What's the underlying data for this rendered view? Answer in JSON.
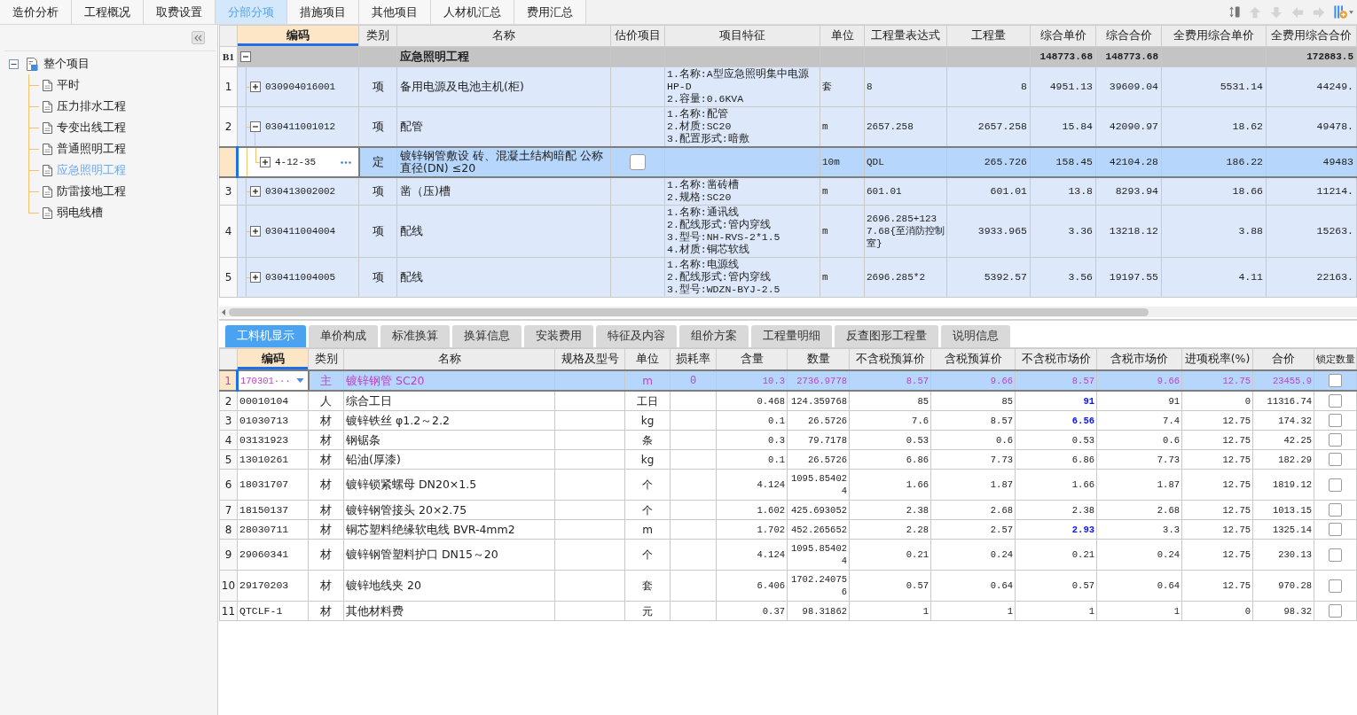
{
  "top_tabs": [
    {
      "label": "造价分析",
      "selected": false
    },
    {
      "label": "工程概况",
      "selected": false
    },
    {
      "label": "取费设置",
      "selected": false
    },
    {
      "label": "分部分项",
      "selected": true
    },
    {
      "label": "措施项目",
      "selected": false
    },
    {
      "label": "其他项目",
      "selected": false
    },
    {
      "label": "人材机汇总",
      "selected": false
    },
    {
      "label": "费用汇总",
      "selected": false
    }
  ],
  "toolbar": [
    {
      "kind": "sort",
      "disabled": false
    },
    {
      "kind": "up",
      "disabled": true
    },
    {
      "kind": "down",
      "disabled": true
    },
    {
      "kind": "left",
      "disabled": true
    },
    {
      "kind": "right",
      "disabled": true
    },
    {
      "kind": "columns",
      "disabled": false
    }
  ],
  "tree": {
    "label": "整个项目",
    "expanded": true,
    "selected": false,
    "children": [
      {
        "label": "平时",
        "selected": false
      },
      {
        "label": "压力排水工程",
        "selected": false
      },
      {
        "label": "专变出线工程",
        "selected": false
      },
      {
        "label": "普通照明工程",
        "selected": false
      },
      {
        "label": "应急照明工程",
        "selected": true
      },
      {
        "label": "防雷接地工程",
        "selected": false
      },
      {
        "label": "弱电线槽",
        "selected": false
      }
    ]
  },
  "bill_table": {
    "columns": [
      {
        "label": "编码",
        "selected": true
      },
      {
        "label": "类别",
        "selected": false
      },
      {
        "label": "名称",
        "selected": false
      },
      {
        "label": "估价项目",
        "selected": false
      },
      {
        "label": "项目特征",
        "selected": false
      },
      {
        "label": "单位",
        "selected": false
      },
      {
        "label": "工程量表达式",
        "selected": false
      },
      {
        "label": "工程量",
        "selected": false
      },
      {
        "label": "综合单价",
        "selected": false
      },
      {
        "label": "综合合价",
        "selected": false
      },
      {
        "label": "全费用综合单价",
        "selected": false
      },
      {
        "label": "全费用综合合价",
        "selected": false
      }
    ],
    "rows": [
      {
        "kind": "section",
        "number": "B1",
        "expanded": true,
        "name": "应急照明工程",
        "unit_price": "148773.68",
        "total": "148773.68",
        "full_total": "172883.5",
        "selected": false
      },
      {
        "kind": "item",
        "number": "1",
        "code": "030904016001",
        "expanded": false,
        "type": "项",
        "name": "备用电源及电池主机(柜)",
        "features": [
          "1.名称:A型应急照明集中电源",
          "HP-D",
          "2.容量:0.6KVA"
        ],
        "unit": "套",
        "expression": "8",
        "quantity": "8",
        "unit_price": "4951.13",
        "total": "39609.04",
        "full_unit_price": "5531.14",
        "full_total": "44249.",
        "selected": false
      },
      {
        "kind": "item",
        "number": "2",
        "code": "030411001012",
        "expanded": true,
        "type": "项",
        "name": "配管",
        "features": [
          "1.名称:配管",
          "2.材质:SC20",
          "3.配置形式:暗敷"
        ],
        "unit": "m",
        "expression": "2657.258",
        "quantity": "2657.258",
        "unit_price": "15.84",
        "total": "42090.97",
        "full_unit_price": "18.62",
        "full_total": "49478.",
        "selected": false
      },
      {
        "kind": "quota",
        "code": "4-12-35",
        "expanded": false,
        "type": "定",
        "name": "镀锌钢管敷设 砖、混凝土结构暗配 公称直径(DN) ≤20",
        "estimate_checked": false,
        "unit": "10m",
        "expression": "QDL",
        "quantity": "265.726",
        "unit_price": "158.45",
        "total": "42104.28",
        "full_unit_price": "186.22",
        "full_total": "49483",
        "selected": true
      },
      {
        "kind": "item",
        "number": "3",
        "code": "030413002002",
        "expanded": false,
        "type": "项",
        "name": "凿（压)槽",
        "features": [
          "1.名称:凿砖槽",
          "2.规格:SC20"
        ],
        "unit": "m",
        "expression": "601.01",
        "quantity": "601.01",
        "unit_price": "13.8",
        "total": "8293.94",
        "full_unit_price": "18.66",
        "full_total": "11214.",
        "selected": false
      },
      {
        "kind": "item",
        "number": "4",
        "code": "030411004004",
        "expanded": false,
        "type": "项",
        "name": "配线",
        "features": [
          "1.名称:通讯线",
          "2.配线形式:管内穿线",
          "3.型号:NH-RVS-2*1.5",
          "4.材质:铜芯软线"
        ],
        "unit": "m",
        "expression": "2696.285+1237.68{至消防控制室}",
        "quantity": "3933.965",
        "unit_price": "3.36",
        "total": "13218.12",
        "full_unit_price": "3.88",
        "full_total": "15263.",
        "selected": false
      },
      {
        "kind": "item",
        "number": "5",
        "code": "030411004005",
        "expanded": false,
        "type": "项",
        "name": "配线",
        "features": [
          "1.名称:电源线",
          "2.配线形式:管内穿线",
          "3.型号:WDZN-BYJ-2.5"
        ],
        "unit": "m",
        "expression": "2696.285*2",
        "quantity": "5392.57",
        "unit_price": "3.56",
        "total": "19197.55",
        "full_unit_price": "4.11",
        "full_total": "22163.",
        "selected": false
      }
    ]
  },
  "detail_tabs": [
    {
      "label": "工料机显示",
      "selected": true
    },
    {
      "label": "单价构成",
      "selected": false
    },
    {
      "label": "标准换算",
      "selected": false
    },
    {
      "label": "换算信息",
      "selected": false
    },
    {
      "label": "安装费用",
      "selected": false
    },
    {
      "label": "特征及内容",
      "selected": false
    },
    {
      "label": "组价方案",
      "selected": false
    },
    {
      "label": "工程量明细",
      "selected": false
    },
    {
      "label": "反查图形工程量",
      "selected": false
    },
    {
      "label": "说明信息",
      "selected": false
    }
  ],
  "detail_table": {
    "columns": [
      {
        "label": "编码",
        "selected": true
      },
      {
        "label": "类别",
        "selected": false
      },
      {
        "label": "名称",
        "selected": false
      },
      {
        "label": "规格及型号",
        "selected": false
      },
      {
        "label": "单位",
        "selected": false
      },
      {
        "label": "损耗率",
        "selected": false
      },
      {
        "label": "含量",
        "selected": false
      },
      {
        "label": "数量",
        "selected": false
      },
      {
        "label": "不含税预算价",
        "selected": false
      },
      {
        "label": "含税预算价",
        "selected": false
      },
      {
        "label": "不含税市场价",
        "selected": false
      },
      {
        "label": "含税市场价",
        "selected": false
      },
      {
        "label": "进项税率(%)",
        "selected": false
      },
      {
        "label": "合价",
        "selected": false
      },
      {
        "label": "锁定数量",
        "selected": false
      }
    ],
    "rows": [
      {
        "number": "1",
        "code": "170301···",
        "type": "主",
        "name": "镀锌钢管 SC20",
        "unit": "m",
        "loss_rate": "0",
        "content": "10.3",
        "quantity": "2736.9778",
        "budget_ex_tax": "8.57",
        "budget_inc_tax": "9.66",
        "market_ex_tax": "8.57",
        "market_changed": false,
        "market_inc_tax": "9.66",
        "tax_rate": "12.75",
        "total": "23455.9",
        "locked": false,
        "selected": true
      },
      {
        "number": "2",
        "code": "00010104",
        "type": "人",
        "name": "综合工日",
        "unit": "工日",
        "content": "0.468",
        "quantity": "124.359768",
        "budget_ex_tax": "85",
        "budget_inc_tax": "85",
        "market_ex_tax": "91",
        "market_changed": true,
        "market_inc_tax": "91",
        "tax_rate": "0",
        "total": "11316.74",
        "locked": false,
        "selected": false
      },
      {
        "number": "3",
        "code": "01030713",
        "type": "材",
        "name": "镀锌铁丝 φ1.2～2.2",
        "unit": "kg",
        "content": "0.1",
        "quantity": "26.5726",
        "budget_ex_tax": "7.6",
        "budget_inc_tax": "8.57",
        "market_ex_tax": "6.56",
        "market_changed": true,
        "market_inc_tax": "7.4",
        "tax_rate": "12.75",
        "total": "174.32",
        "locked": false,
        "selected": false
      },
      {
        "number": "4",
        "code": "03131923",
        "type": "材",
        "name": "钢锯条",
        "unit": "条",
        "content": "0.3",
        "quantity": "79.7178",
        "budget_ex_tax": "0.53",
        "budget_inc_tax": "0.6",
        "market_ex_tax": "0.53",
        "market_changed": false,
        "market_inc_tax": "0.6",
        "tax_rate": "12.75",
        "total": "42.25",
        "locked": false,
        "selected": false
      },
      {
        "number": "5",
        "code": "13010261",
        "type": "材",
        "name": "铅油(厚漆)",
        "unit": "kg",
        "content": "0.1",
        "quantity": "26.5726",
        "budget_ex_tax": "6.86",
        "budget_inc_tax": "7.73",
        "market_ex_tax": "6.86",
        "market_changed": false,
        "market_inc_tax": "7.73",
        "tax_rate": "12.75",
        "total": "182.29",
        "locked": false,
        "selected": false
      },
      {
        "number": "6",
        "code": "18031707",
        "type": "材",
        "name": "镀锌锁紧螺母 DN20×1.5",
        "unit": "个",
        "content": "4.124",
        "quantity": "1095.854024",
        "budget_ex_tax": "1.66",
        "budget_inc_tax": "1.87",
        "market_ex_tax": "1.66",
        "market_changed": false,
        "market_inc_tax": "1.87",
        "tax_rate": "12.75",
        "total": "1819.12",
        "locked": false,
        "selected": false
      },
      {
        "number": "7",
        "code": "18150137",
        "type": "材",
        "name": "镀锌钢管接头 20×2.75",
        "unit": "个",
        "content": "1.602",
        "quantity": "425.693052",
        "budget_ex_tax": "2.38",
        "budget_inc_tax": "2.68",
        "market_ex_tax": "2.38",
        "market_changed": false,
        "market_inc_tax": "2.68",
        "tax_rate": "12.75",
        "total": "1013.15",
        "locked": false,
        "selected": false
      },
      {
        "number": "8",
        "code": "28030711",
        "type": "材",
        "name": "铜芯塑料绝缘软电线 BVR-4mm2",
        "unit": "m",
        "content": "1.702",
        "quantity": "452.265652",
        "budget_ex_tax": "2.28",
        "budget_inc_tax": "2.57",
        "market_ex_tax": "2.93",
        "market_changed": true,
        "market_inc_tax": "3.3",
        "tax_rate": "12.75",
        "total": "1325.14",
        "locked": false,
        "selected": false
      },
      {
        "number": "9",
        "code": "29060341",
        "type": "材",
        "name": "镀锌钢管塑料护口 DN15～20",
        "unit": "个",
        "content": "4.124",
        "quantity": "1095.854024",
        "budget_ex_tax": "0.21",
        "budget_inc_tax": "0.24",
        "market_ex_tax": "0.21",
        "market_changed": false,
        "market_inc_tax": "0.24",
        "tax_rate": "12.75",
        "total": "230.13",
        "locked": false,
        "selected": false
      },
      {
        "number": "10",
        "code": "29170203",
        "type": "材",
        "name": "镀锌地线夹 20",
        "unit": "套",
        "content": "6.406",
        "quantity": "1702.240756",
        "budget_ex_tax": "0.57",
        "budget_inc_tax": "0.64",
        "market_ex_tax": "0.57",
        "market_changed": false,
        "market_inc_tax": "0.64",
        "tax_rate": "12.75",
        "total": "970.28",
        "locked": false,
        "selected": false
      },
      {
        "number": "11",
        "code": "QTCLF-1",
        "type": "材",
        "name": "其他材料费",
        "unit": "元",
        "content": "0.37",
        "quantity": "98.31862",
        "budget_ex_tax": "1",
        "budget_inc_tax": "1",
        "market_ex_tax": "1",
        "market_changed": false,
        "market_inc_tax": "1",
        "tax_rate": "0",
        "total": "98.32",
        "locked": false,
        "selected": false
      }
    ]
  }
}
